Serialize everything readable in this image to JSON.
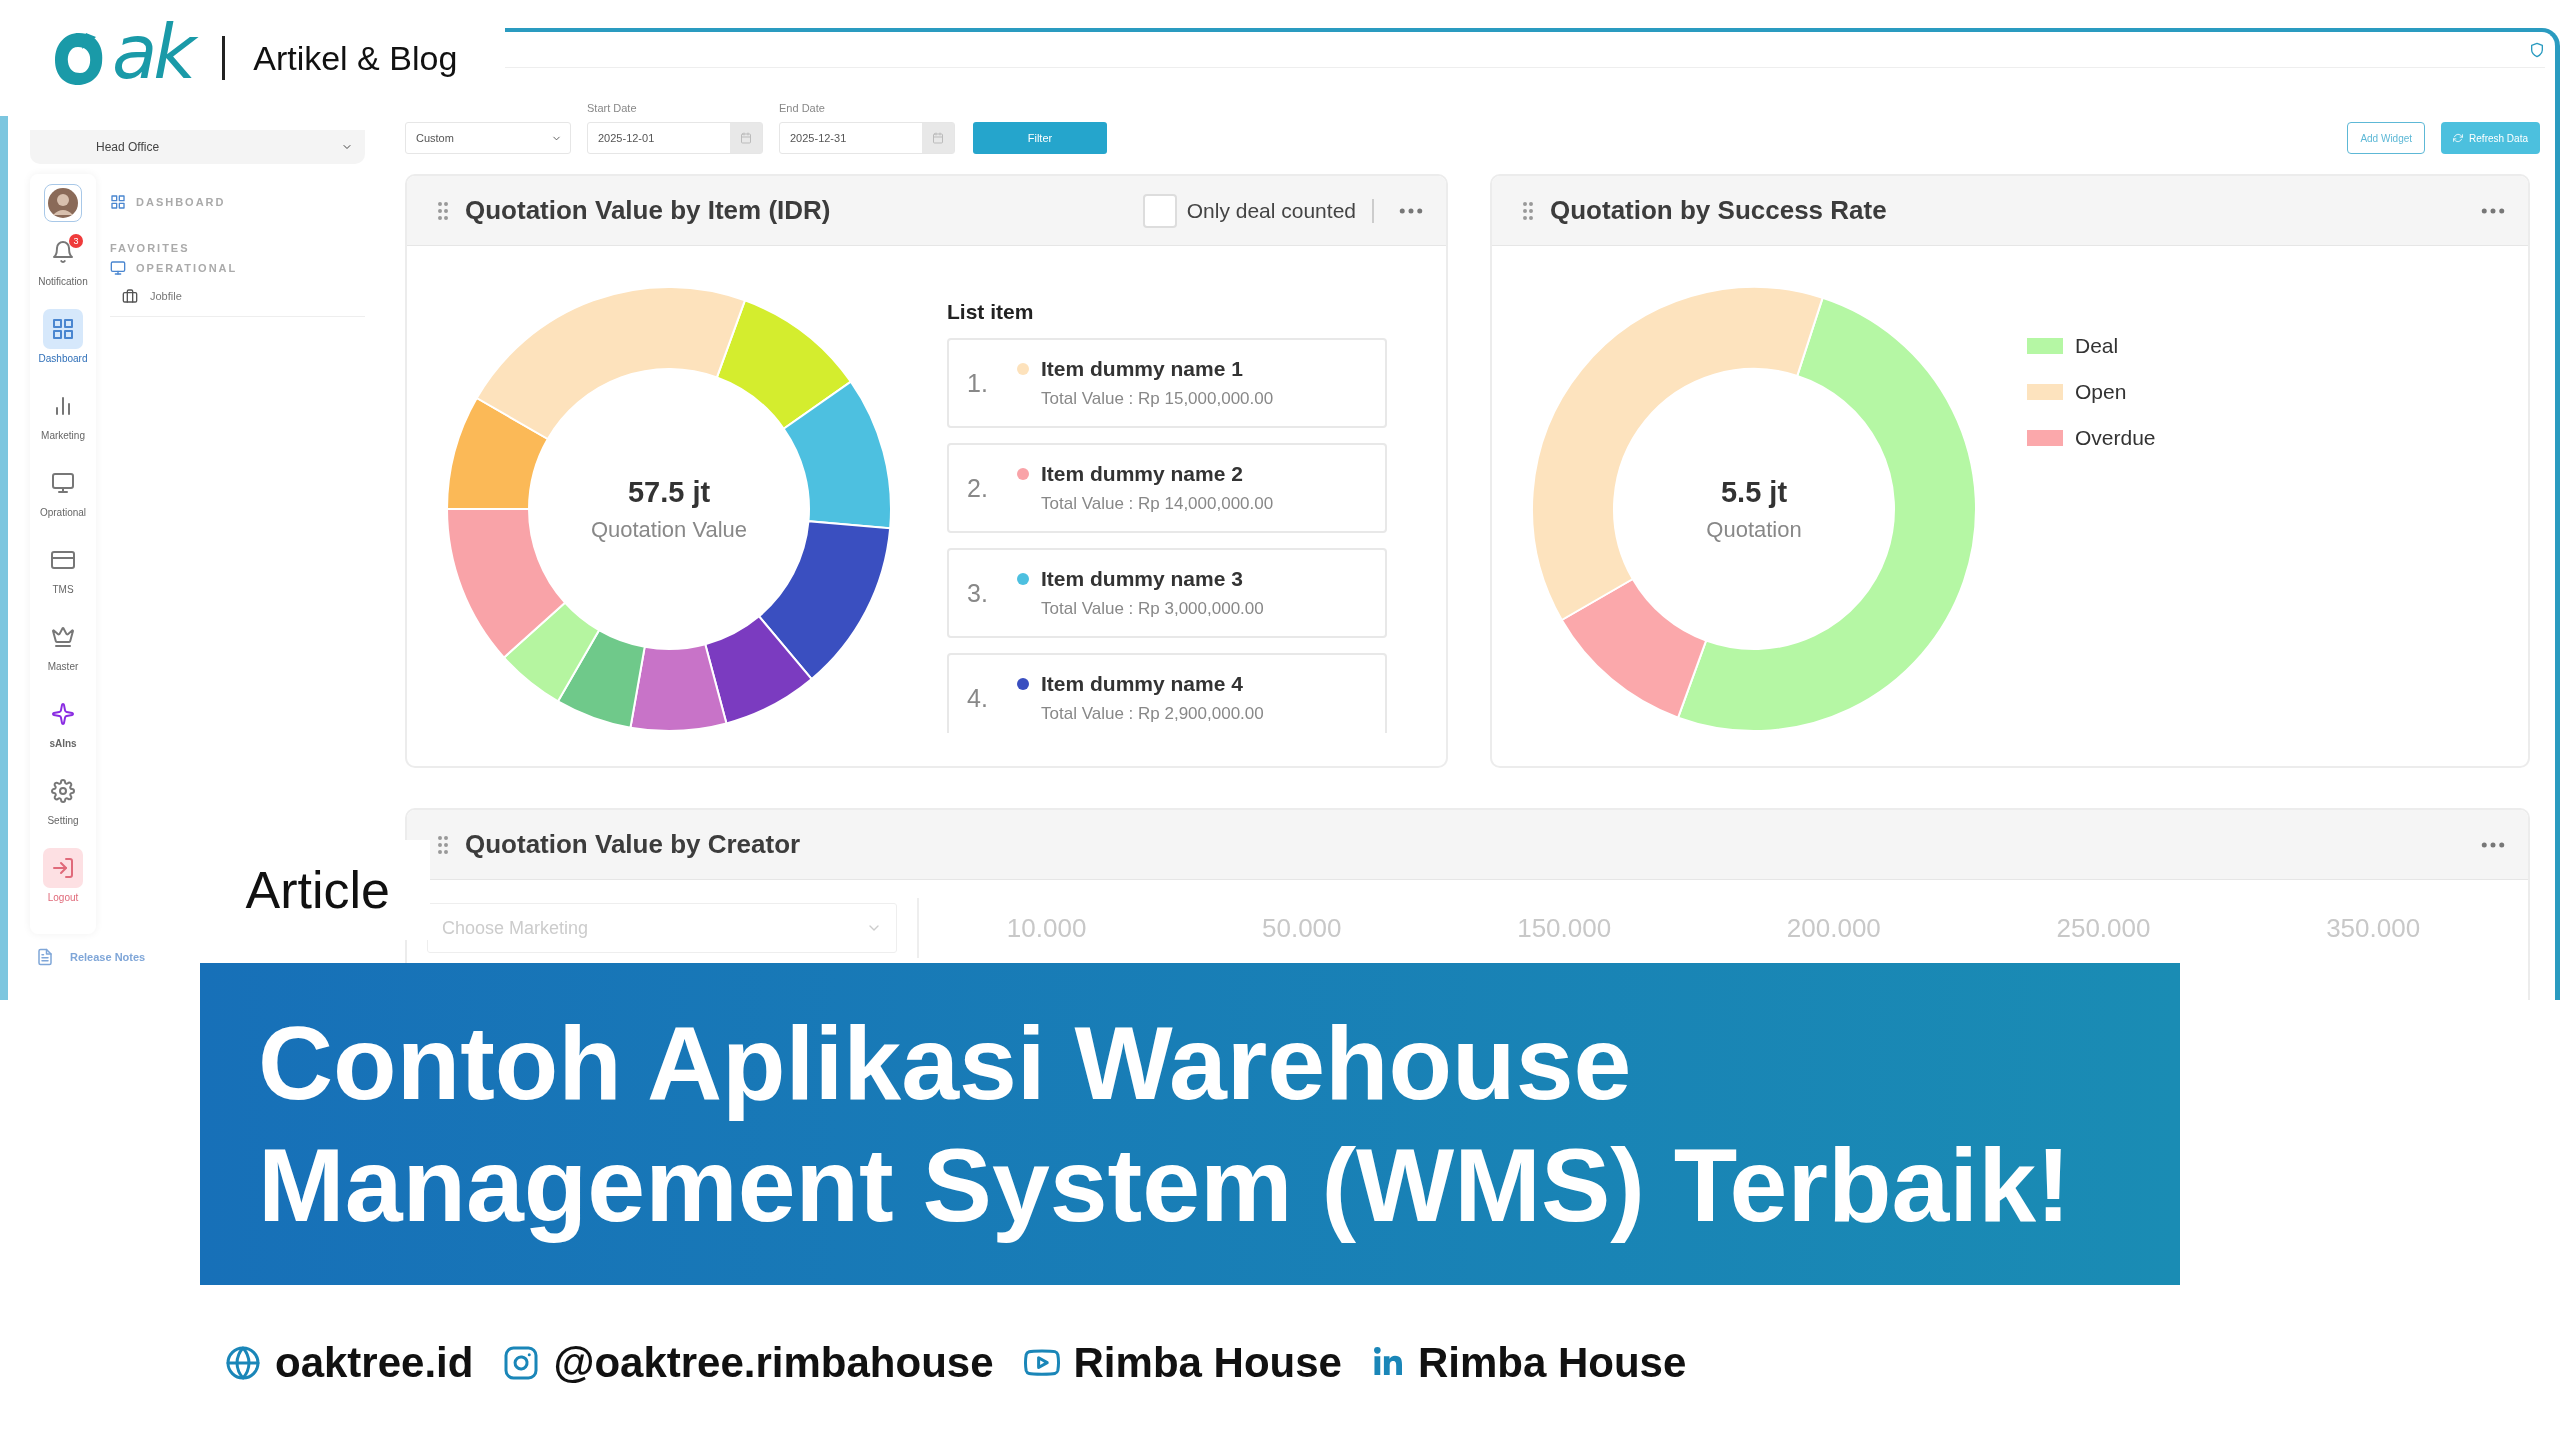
{
  "brand": {
    "logo_text": "ak",
    "label": "Artikel & Blog"
  },
  "sidebar": {
    "office": "Head Office",
    "rail": [
      {
        "label": "Notification",
        "badge": "3",
        "selected": false,
        "kind": "nav"
      },
      {
        "label": "Dashboard",
        "selected": true,
        "kind": "nav"
      },
      {
        "label": "Marketing",
        "selected": false,
        "kind": "nav"
      },
      {
        "label": "Oprational",
        "selected": false,
        "kind": "nav"
      },
      {
        "label": "TMS",
        "selected": false,
        "kind": "nav"
      },
      {
        "label": "Master",
        "selected": false,
        "kind": "nav"
      },
      {
        "label": "sAIns",
        "selected": false,
        "kind": "ai"
      },
      {
        "label": "Setting",
        "selected": false,
        "kind": "nav"
      },
      {
        "label": "Logout",
        "selected": false,
        "kind": "logout"
      }
    ],
    "menu": {
      "section": "DASHBOARD",
      "favorites": "FAVORITES",
      "group": "OPERATIONAL",
      "items": [
        "Jobfile"
      ]
    },
    "release_notes": "Release Notes"
  },
  "filters": {
    "period": "Custom",
    "start_label": "Start Date",
    "start": "2025-12-01",
    "end_label": "End Date",
    "end": "2025-12-31",
    "filter_button": "Filter"
  },
  "actions": {
    "add_widget": "Add Widget",
    "refresh": "Refresh Data"
  },
  "item_card": {
    "title": "Quotation Value by Item (IDR)",
    "only_deal": {
      "label": "Only deal counted",
      "checked": false
    },
    "total": "57.5 jt",
    "total_label": "Quotation Value",
    "list_title": "List item",
    "items": [
      {
        "number": "1.",
        "name": "Item dummy name 1",
        "value": "Total Value : Rp 15,000,000.00",
        "color": "#fde2bc"
      },
      {
        "number": "2.",
        "name": "Item dummy name 2",
        "value": "Total Value : Rp 14,000,000.00",
        "color": "#f9a3a8"
      },
      {
        "number": "3.",
        "name": "Item dummy name 3",
        "value": "Total Value : Rp 3,000,000.00",
        "color": "#4dc0e0"
      },
      {
        "number": "4.",
        "name": "Item dummy name 4",
        "value": "Total Value : Rp 2,900,000.00",
        "color": "#3a4fc0"
      }
    ]
  },
  "success_card": {
    "title": "Quotation by Success Rate",
    "total": "5.5 jt",
    "total_label": "Quotation",
    "legend": [
      {
        "label": "Deal",
        "color": "#b5f7a4"
      },
      {
        "label": "Open",
        "color": "#fde3be"
      },
      {
        "label": "Overdue",
        "color": "#fba8ab"
      }
    ]
  },
  "creator_card": {
    "title": "Quotation Value by Creator",
    "select_placeholder": "Choose Marketing",
    "axis_labels": [
      "10.000",
      "50.000",
      "150.000",
      "200.000",
      "250.000",
      "350.000"
    ]
  },
  "article_label": "Article",
  "headline": [
    "Contoh Aplikasi Warehouse",
    "Management System (WMS) Terbaik!"
  ],
  "socials": [
    {
      "kind": "web",
      "text": "oaktree.id"
    },
    {
      "kind": "instagram",
      "text": "@oaktree.rimbahouse"
    },
    {
      "kind": "youtube",
      "text": "Rimba House"
    },
    {
      "kind": "linkedin",
      "text": "Rimba House"
    }
  ]
}
